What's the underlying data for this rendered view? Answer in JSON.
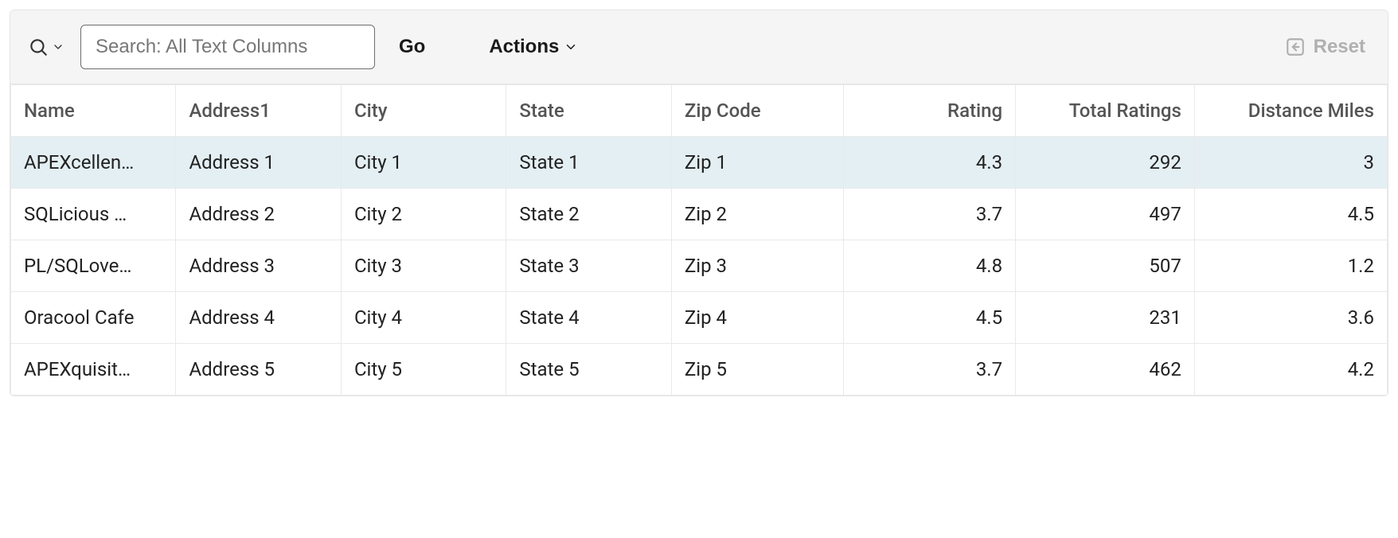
{
  "toolbar": {
    "search_placeholder": "Search: All Text Columns",
    "go_label": "Go",
    "actions_label": "Actions",
    "reset_label": "Reset"
  },
  "table": {
    "columns": [
      "Name",
      "Address1",
      "City",
      "State",
      "Zip Code",
      "Rating",
      "Total Ratings",
      "Distance Miles"
    ],
    "rows": [
      {
        "name": "APEXcellen…",
        "address1": "Address 1",
        "city": "City 1",
        "state": "State 1",
        "zip": "Zip 1",
        "rating": "4.3",
        "total_ratings": "292",
        "distance": "3",
        "selected": true
      },
      {
        "name": "SQLicious …",
        "address1": "Address 2",
        "city": "City 2",
        "state": "State 2",
        "zip": "Zip 2",
        "rating": "3.7",
        "total_ratings": "497",
        "distance": "4.5",
        "selected": false
      },
      {
        "name": "PL/SQLove…",
        "address1": "Address 3",
        "city": "City 3",
        "state": "State 3",
        "zip": "Zip 3",
        "rating": "4.8",
        "total_ratings": "507",
        "distance": "1.2",
        "selected": false
      },
      {
        "name": "Oracool Cafe",
        "address1": "Address 4",
        "city": "City 4",
        "state": "State 4",
        "zip": "Zip 4",
        "rating": "4.5",
        "total_ratings": "231",
        "distance": "3.6",
        "selected": false
      },
      {
        "name": "APEXquisit…",
        "address1": "Address 5",
        "city": "City 5",
        "state": "State 5",
        "zip": "Zip 5",
        "rating": "3.7",
        "total_ratings": "462",
        "distance": "4.2",
        "selected": false
      }
    ]
  }
}
